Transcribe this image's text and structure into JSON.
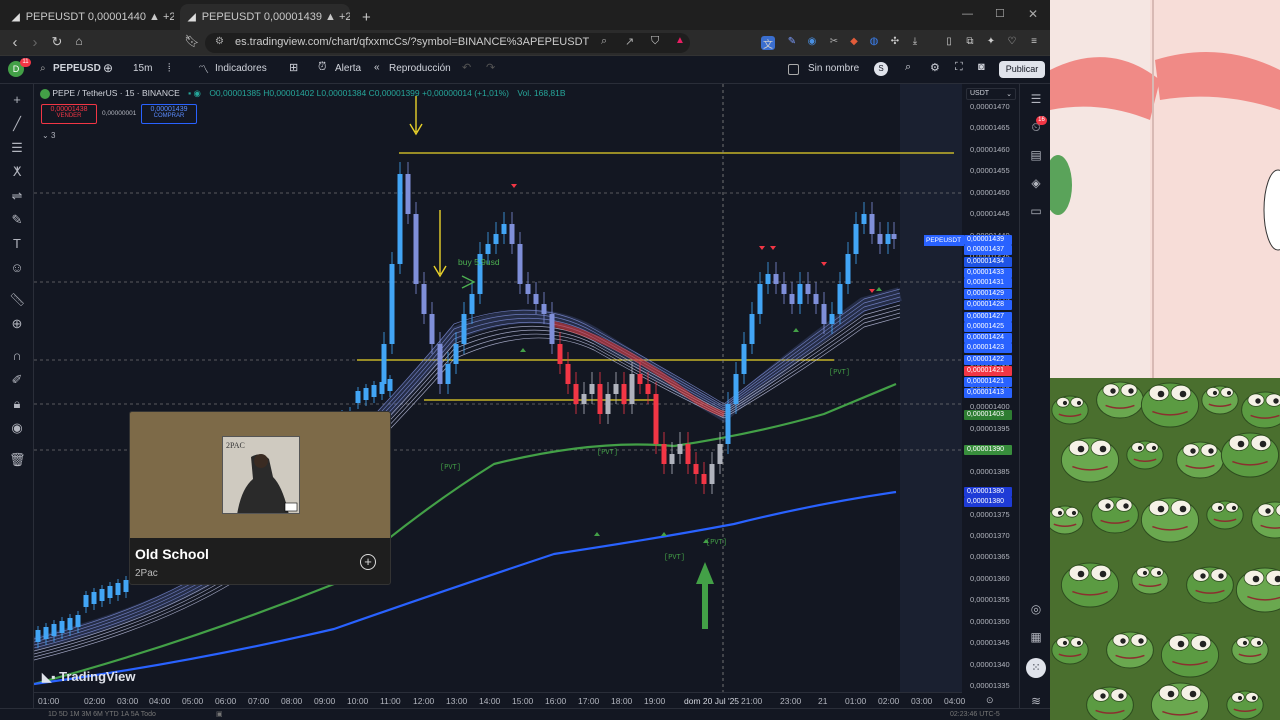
{
  "browser": {
    "tabs": [
      {
        "title": "PEPEUSDT 0,00001440 ▲ +2,71% Sin",
        "active": false
      },
      {
        "title": "PEPEUSDT 0,00001439 ▲ +2,64%",
        "active": true
      }
    ],
    "url": "es.tradingview.com/chart/qfxxmcCs/?symbol=BINANCE%3APEPEUSDT",
    "new_tab": "+"
  },
  "toolbar": {
    "avatar_letter": "D",
    "avatar_badge": "11",
    "symbol": "PEPEUSD",
    "interval": "15m",
    "indicators": "Indicadores",
    "alert": "Alerta",
    "replay": "Reproducción",
    "layout_name": "Sin nombre",
    "layout_badge": "S",
    "publish": "Publicar"
  },
  "legend": {
    "pair": "PEPE / TetherUS · 15 · BINANCE",
    "ohlc": "O0,00001385 H0,00001402 L0,00001384 C0,00001399 +0,00000014 (+1,01%)",
    "vol": "Vol. 168,81B",
    "sell_price": "0,00001438",
    "sell_label": "VENDER",
    "spread": "0,00000001",
    "buy_price": "0,00001439",
    "buy_label": "COMPRAR",
    "collapse": "3"
  },
  "annotations": {
    "buy_note": "buy 5,9usd",
    "symbol_tag": "PEPEUSDT"
  },
  "axis": {
    "currency": "USDT",
    "prices": [
      "0,00001470",
      "0,00001465",
      "0,00001460",
      "0,00001455",
      "0,00001450",
      "0,00001445",
      "0,00001440",
      "0,00001435",
      "0,00001430",
      "0,00001425",
      "0,00001420",
      "0,00001415",
      "0,00001410",
      "0,00001405",
      "0,00001400",
      "0,00001395",
      "0,00001390",
      "0,00001385",
      "0,00001380",
      "0,00001375",
      "0,00001370",
      "0,00001365",
      "0,00001360",
      "0,00001355",
      "0,00001350",
      "0,00001345",
      "0,00001340",
      "0,00001335"
    ],
    "badges": [
      {
        "label": "0,00001439",
        "color": "#2962ff"
      },
      {
        "label": "0,00001437",
        "color": "#2962ff"
      },
      {
        "label": "0,00001434",
        "color": "#1e53e5"
      },
      {
        "label": "0,00001433",
        "color": "#2962ff"
      },
      {
        "label": "0,00001431",
        "color": "#2962ff"
      },
      {
        "label": "0,00001429",
        "color": "#2962ff"
      },
      {
        "label": "0,00001428",
        "color": "#2962ff"
      },
      {
        "label": "0,00001427",
        "color": "#2962ff"
      },
      {
        "label": "0,00001425",
        "color": "#2962ff"
      },
      {
        "label": "0,00001424",
        "color": "#2962ff"
      },
      {
        "label": "0,00001423",
        "color": "#2962ff"
      },
      {
        "label": "0,00001422",
        "color": "#2962ff"
      },
      {
        "label": "0,00001421",
        "color": "#f23645"
      },
      {
        "label": "0,00001421",
        "color": "#2962ff"
      },
      {
        "label": "0,00001413",
        "color": "#2962ff"
      },
      {
        "label": "0,00001403",
        "color": "#2e7d32"
      },
      {
        "label": "0,00001390",
        "color": "#388e3c"
      },
      {
        "label": "0,00001380",
        "color": "#1e3bd6"
      },
      {
        "label": "0,00001380",
        "color": "#1e3bd6"
      }
    ]
  },
  "time_axis": [
    "01:00",
    "02:00",
    "03:00",
    "04:00",
    "05:00",
    "06:00",
    "07:00",
    "08:00",
    "09:00",
    "10:00",
    "11:00",
    "12:00",
    "13:00",
    "14:00",
    "15:00",
    "16:00",
    "17:00",
    "18:00",
    "19:00",
    "dom 20 Jul '25",
    "21:00",
    "23:00",
    "21",
    "01:00",
    "02:00",
    "03:00",
    "04:00"
  ],
  "popup": {
    "song": "Old School",
    "artist": "2Pac",
    "cover_text": "2PAC"
  },
  "watermark": "TradingView",
  "bottom": {
    "ranges": "1D 5D 1M 3M 6M YTD 1A 5A Todo",
    "clock": "02:23:46 UTC-5"
  }
}
